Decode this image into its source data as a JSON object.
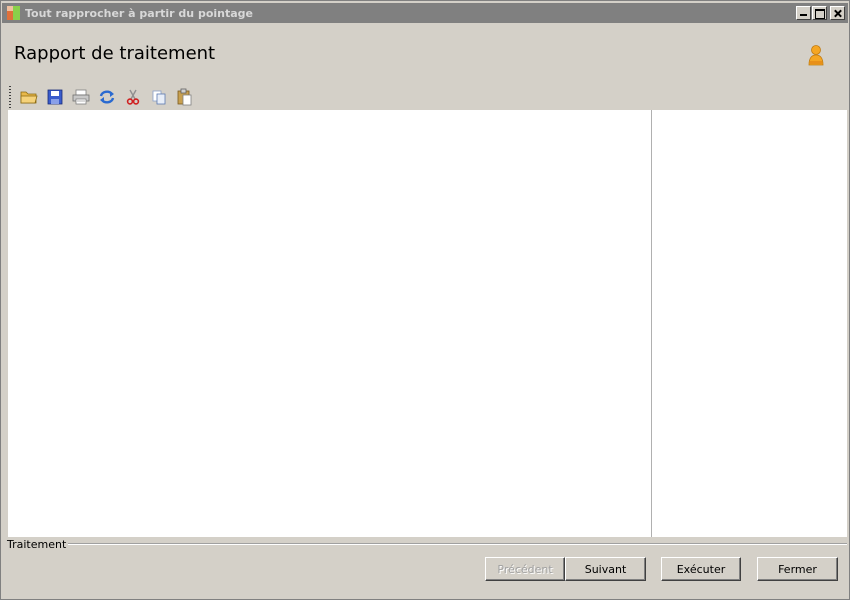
{
  "window": {
    "title": "Tout rapprocher à partir du pointage"
  },
  "header": {
    "title": "Rapport de traitement",
    "user_icon": "user-icon"
  },
  "toolbar": {
    "items": [
      {
        "icon": "open-folder-icon"
      },
      {
        "icon": "save-icon"
      },
      {
        "icon": "print-icon"
      },
      {
        "icon": "refresh-icon"
      },
      {
        "icon": "cut-icon"
      },
      {
        "icon": "copy-icon"
      },
      {
        "icon": "paste-icon"
      }
    ]
  },
  "group": {
    "label": "Traitement"
  },
  "buttons": {
    "previous": "Précédent",
    "next": "Suivant",
    "execute": "Exécuter",
    "close": "Fermer"
  },
  "colors": {
    "titlebar_inactive": "#808080",
    "face": "#d4d0c8",
    "panel": "#ffffff"
  }
}
